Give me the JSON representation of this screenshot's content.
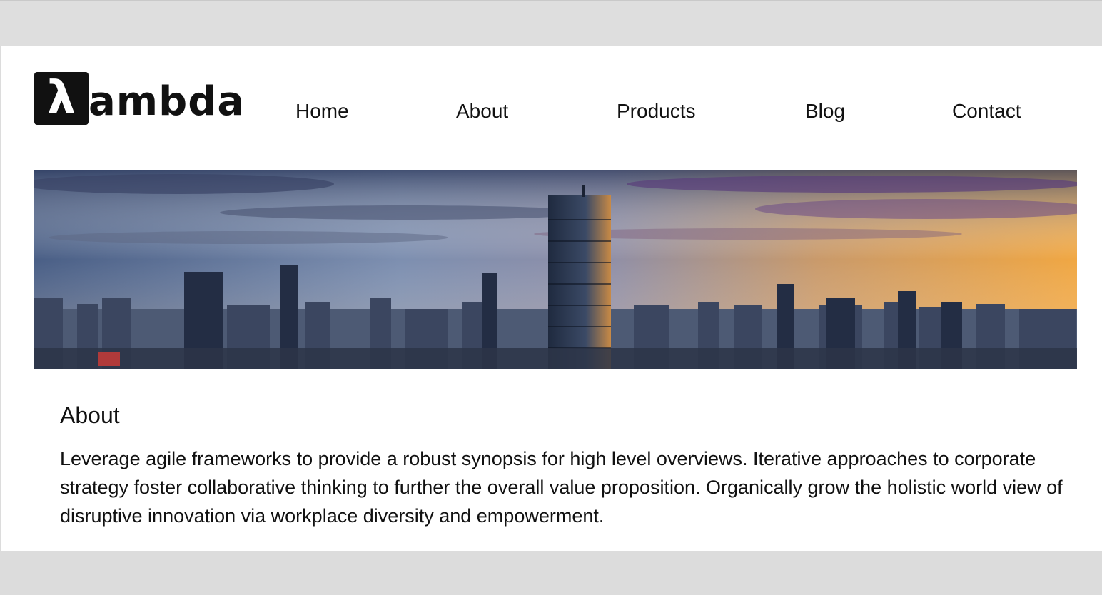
{
  "brand": {
    "logo_glyph": "λ",
    "logo_text": "ambda",
    "primary_color": "#111111"
  },
  "nav": {
    "items": [
      {
        "label": "Home"
      },
      {
        "label": "About"
      },
      {
        "label": "Products"
      },
      {
        "label": "Blog"
      },
      {
        "label": "Contact"
      }
    ]
  },
  "hero": {
    "image": "city-skyline-sunset"
  },
  "about": {
    "title": "About",
    "body": "Leverage agile frameworks to provide a robust synopsis for high level overviews. Iterative approaches to corporate strategy foster collaborative thinking to further the overall value proposition. Organically grow the holistic world view of disruptive innovation via workplace diversity and empowerment."
  }
}
